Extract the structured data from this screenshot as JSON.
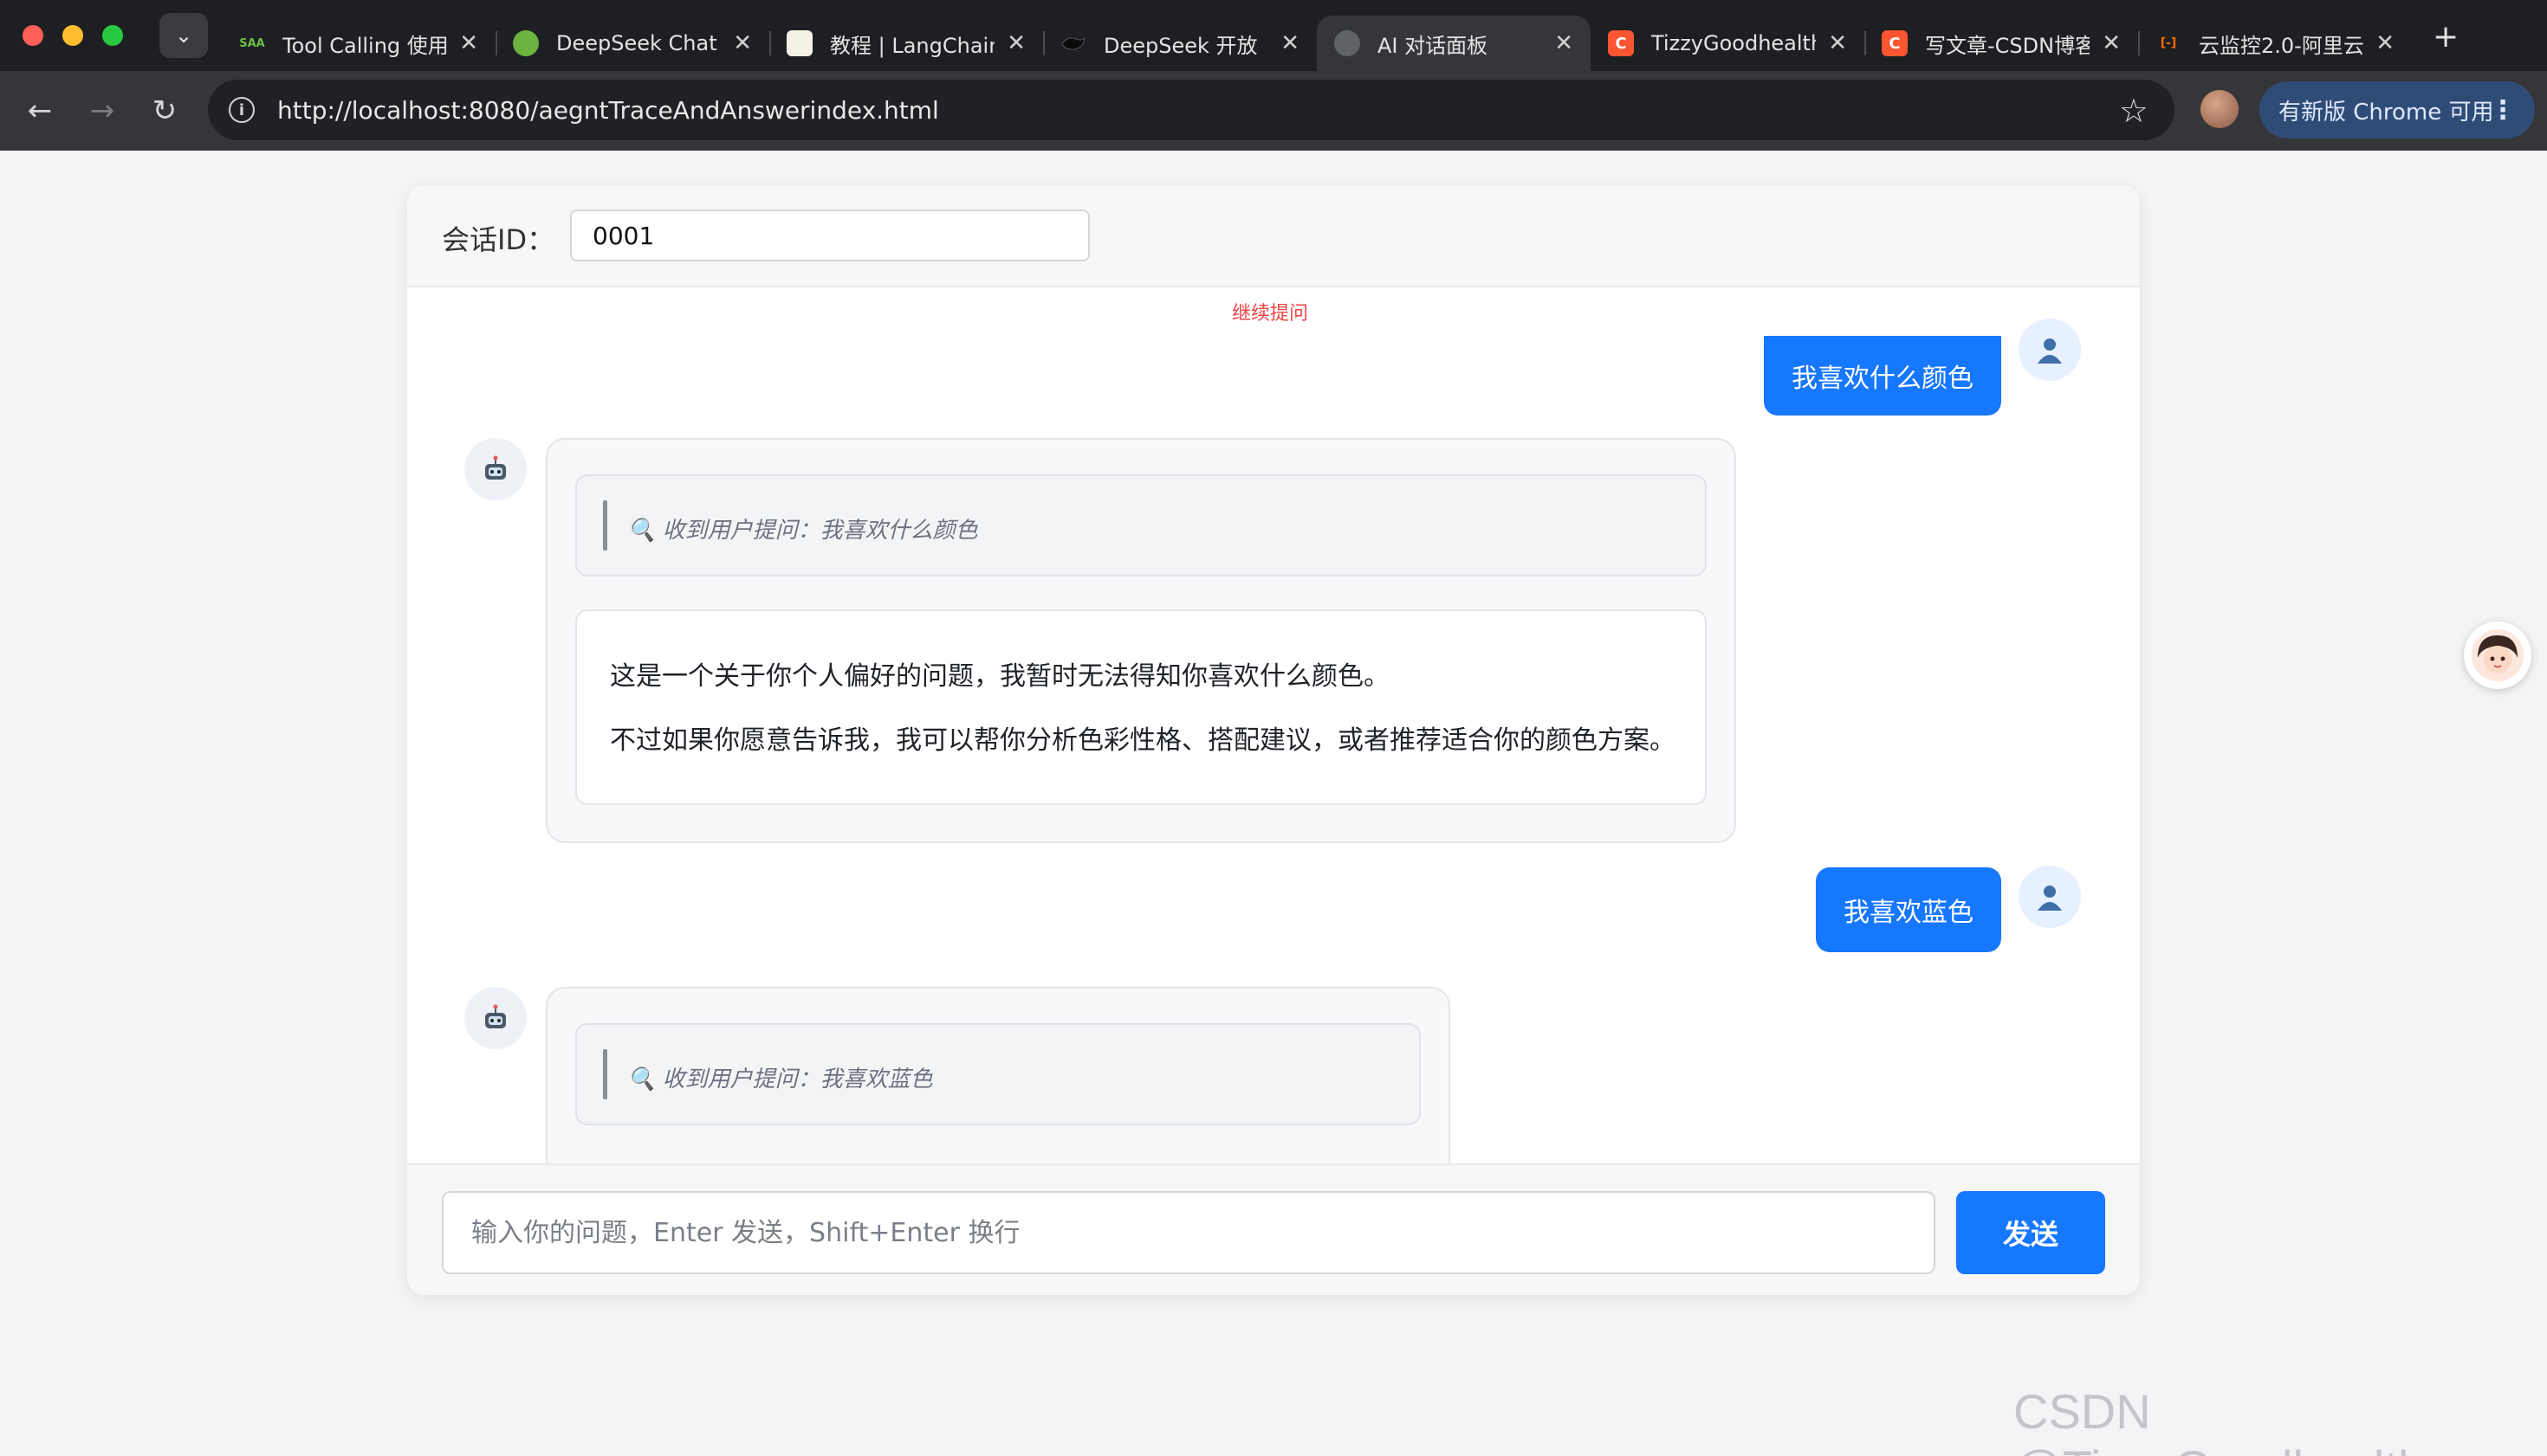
{
  "browser": {
    "tabs": [
      {
        "title": "Tool Calling 使用",
        "favicon": "saa-icon",
        "favicon_text": "SAA",
        "active": false
      },
      {
        "title": "DeepSeek Chat",
        "favicon": "spring-leaf-icon",
        "favicon_text": "",
        "active": false
      },
      {
        "title": "教程 | LangChain",
        "favicon": "langchain-icon",
        "favicon_text": "",
        "active": false
      },
      {
        "title": "DeepSeek 开放",
        "favicon": "deepseek-whale-icon",
        "favicon_text": "",
        "active": false
      },
      {
        "title": "AI 对话面板",
        "favicon": "globe-icon",
        "favicon_text": "",
        "active": true
      },
      {
        "title": "TizzyGoodhealth",
        "favicon": "csdn-icon",
        "favicon_text": "C",
        "active": false
      },
      {
        "title": "写文章-CSDN博客",
        "favicon": "csdn-icon",
        "favicon_text": "C",
        "active": false
      },
      {
        "title": "云监控2.0-阿里云",
        "favicon": "aliyun-icon",
        "favicon_text": "[-]",
        "active": false
      }
    ],
    "url": "http://localhost:8080/aegntTraceAndAnswerindex.html",
    "update_label": "有新版 Chrome 可用"
  },
  "header": {
    "session_label": "会话ID：",
    "session_value": "0001"
  },
  "chat": {
    "continue_tip": "继续提问",
    "messages": [
      {
        "role": "user",
        "text": "我喜欢什么颜色"
      },
      {
        "role": "ai",
        "trace": "🔍 收到用户提问：我喜欢什么颜色",
        "answer": [
          "这是一个关于你个人偏好的问题，我暂时无法得知你喜欢什么颜色。",
          "不过如果你愿意告诉我，我可以帮你分析色彩性格、搭配建议，或者推荐适合你的颜色方案。"
        ]
      },
      {
        "role": "user",
        "text": "我喜欢蓝色"
      },
      {
        "role": "ai",
        "trace": "🔍 收到用户提问：我喜欢蓝色",
        "answer": []
      }
    ]
  },
  "composer": {
    "placeholder": "输入你的问题，Enter 发送，Shift+Enter 换行",
    "send_label": "发送"
  },
  "watermark": "CSDN @TizzyGoodhealth",
  "colors": {
    "accent": "#1677ff",
    "tip": "#ef4444"
  }
}
